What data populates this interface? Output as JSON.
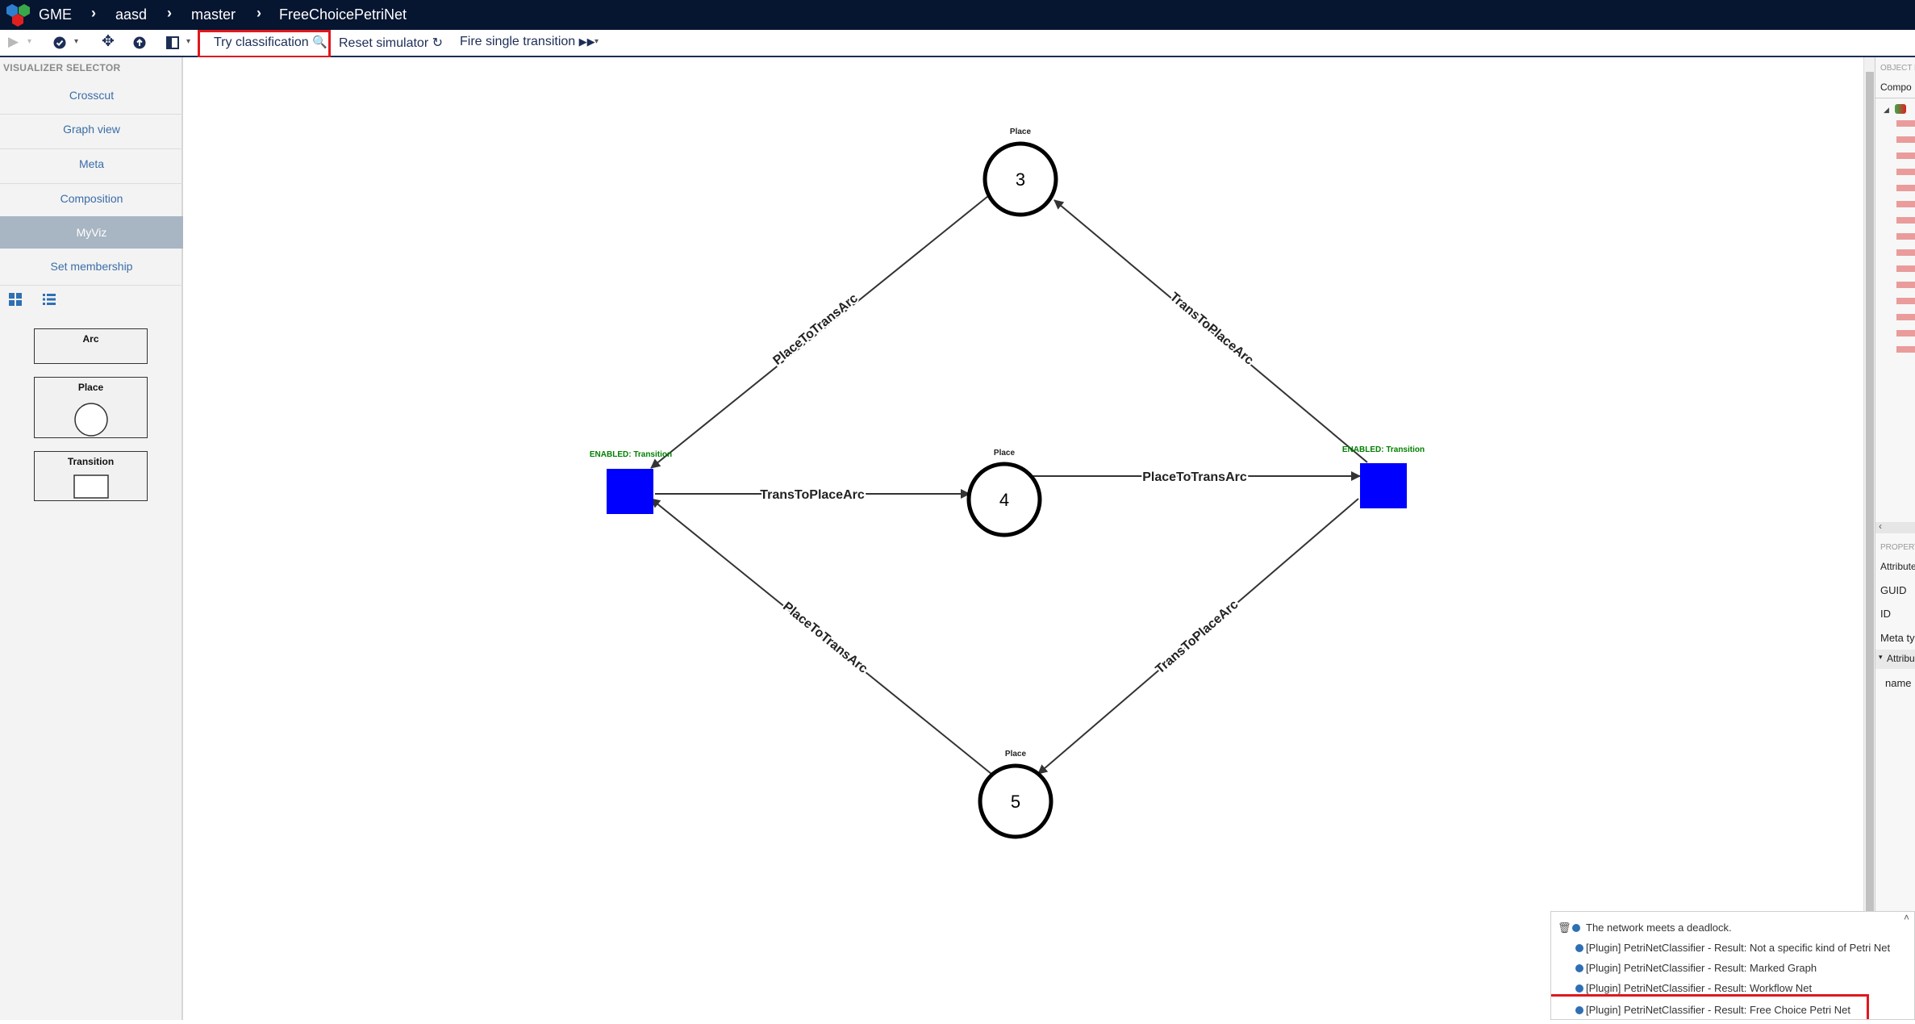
{
  "app": {
    "name": "GME",
    "breadcrumb": [
      "aasd",
      "master",
      "FreeChoicePetriNet"
    ]
  },
  "toolbar": {
    "try_classification": "Try classification",
    "reset_simulator": "Reset simulator",
    "fire_single_transition": "Fire single transition"
  },
  "visualizer": {
    "title": "VISUALIZER SELECTOR",
    "items": [
      "Crosscut",
      "Graph view",
      "Meta",
      "Composition",
      "MyViz",
      "Set membership"
    ],
    "active": "MyViz"
  },
  "palette": {
    "items": [
      "Arc",
      "Place",
      "Transition"
    ]
  },
  "petri_net": {
    "places": [
      {
        "type_label": "Place",
        "tokens": "3"
      },
      {
        "type_label": "Place",
        "tokens": "4"
      },
      {
        "type_label": "Place",
        "tokens": "5"
      }
    ],
    "transitions": [
      {
        "label": "ENABLED: Transition",
        "color": "#0000ff"
      },
      {
        "label": "ENABLED: Transition",
        "color": "#0000ff"
      }
    ],
    "arcs": [
      {
        "label": "PlaceToTransArc",
        "from": "place-3",
        "to": "transition-left"
      },
      {
        "label": "TransToPlaceArc",
        "from": "transition-right",
        "to": "place-3"
      },
      {
        "label": "TransToPlaceArc",
        "from": "transition-left",
        "to": "place-4"
      },
      {
        "label": "PlaceToTransArc",
        "from": "place-4",
        "to": "transition-right"
      },
      {
        "label": "PlaceToTransArc",
        "from": "place-5",
        "to": "transition-left"
      },
      {
        "label": "TransToPlaceArc",
        "from": "transition-right",
        "to": "place-5"
      }
    ]
  },
  "right_panel": {
    "object_browser_title": "OBJECT B",
    "composition_tab": "Compo",
    "property_title": "PROPERT",
    "attributes_tab": "Attribute",
    "rows": [
      "GUID",
      "ID",
      "Meta ty"
    ],
    "attributes_section": "Attribu",
    "name_row": "name"
  },
  "notifications": [
    "The network meets a deadlock.",
    "[Plugin] PetriNetClassifier - Result: Not a specific kind of Petri Net",
    "[Plugin] PetriNetClassifier - Result: Marked Graph",
    "[Plugin] PetriNetClassifier - Result: Workflow Net",
    "[Plugin] PetriNetClassifier - Result: Free Choice Petri Net"
  ],
  "colors": {
    "topbar": "#061530",
    "accent": "#1c2e57",
    "highlight": "#e0181e",
    "enabled": "#008000",
    "transition": "#0000ff"
  }
}
